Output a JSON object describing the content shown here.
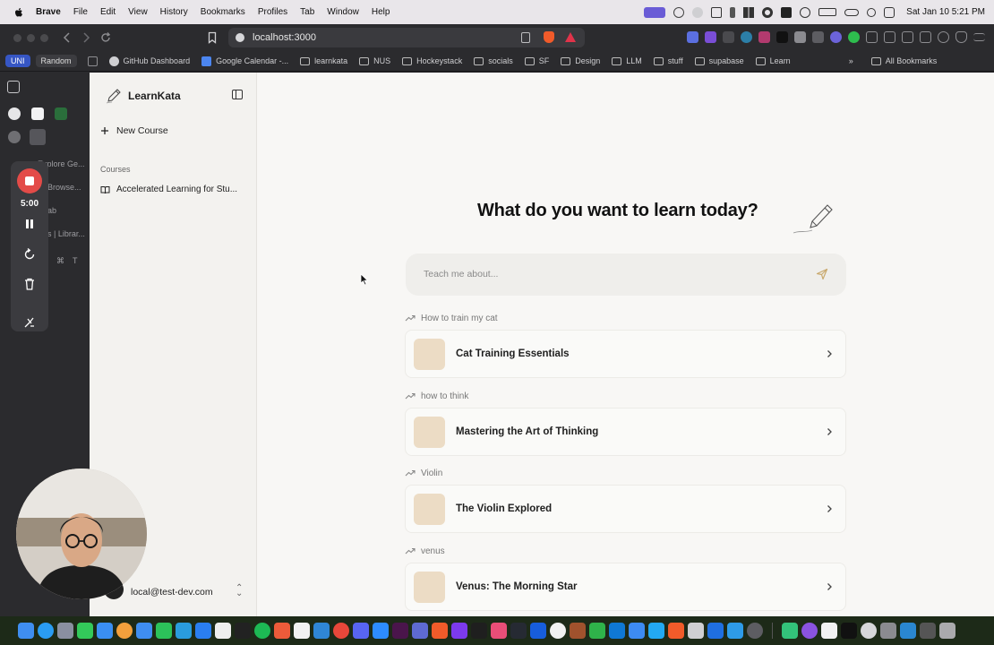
{
  "menubar": {
    "app": "Brave",
    "items": [
      "File",
      "Edit",
      "View",
      "History",
      "Bookmarks",
      "Profiles",
      "Tab",
      "Window",
      "Help"
    ],
    "clock": "Sat Jan 10  5:21 PM"
  },
  "browser": {
    "url": "localhost:3000",
    "profile_badge": "UNI",
    "random_label": "Random",
    "bookmarks": [
      "GitHub Dashboard",
      "Google Calendar -...",
      "learnkata",
      "NUS",
      "Hockeystack",
      "socials",
      "SF",
      "Design",
      "LLM",
      "stuff",
      "supabase",
      "Learn"
    ],
    "bookmarks_more": "»",
    "all_bookmarks": "All Bookmarks",
    "tab_labels": [
      "Explore Ge...",
      "Browse...",
      "ab",
      "s | Librar..."
    ],
    "shortcut_hint": [
      "⌘",
      "T"
    ]
  },
  "recorder": {
    "time": "5:00"
  },
  "app": {
    "brand": "LearnKata",
    "new_course": "New Course",
    "courses_label": "Courses",
    "courses": [
      "Accelerated Learning for Stu..."
    ],
    "account_email": "local@test-dev.com",
    "headline": "What do you want to learn today?",
    "prompt_placeholder": "Teach me about...",
    "suggestions": [
      {
        "query": "How to train my cat",
        "title": "Cat Training Essentials"
      },
      {
        "query": "how to think",
        "title": "Mastering the Art of Thinking"
      },
      {
        "query": "Violin",
        "title": "The Violin Explored"
      },
      {
        "query": "venus",
        "title": "Venus: The Morning Star"
      }
    ]
  },
  "colors": {
    "accent": "#c9a96e",
    "record": "#e34b48",
    "thumb": "#ecdcc5"
  }
}
